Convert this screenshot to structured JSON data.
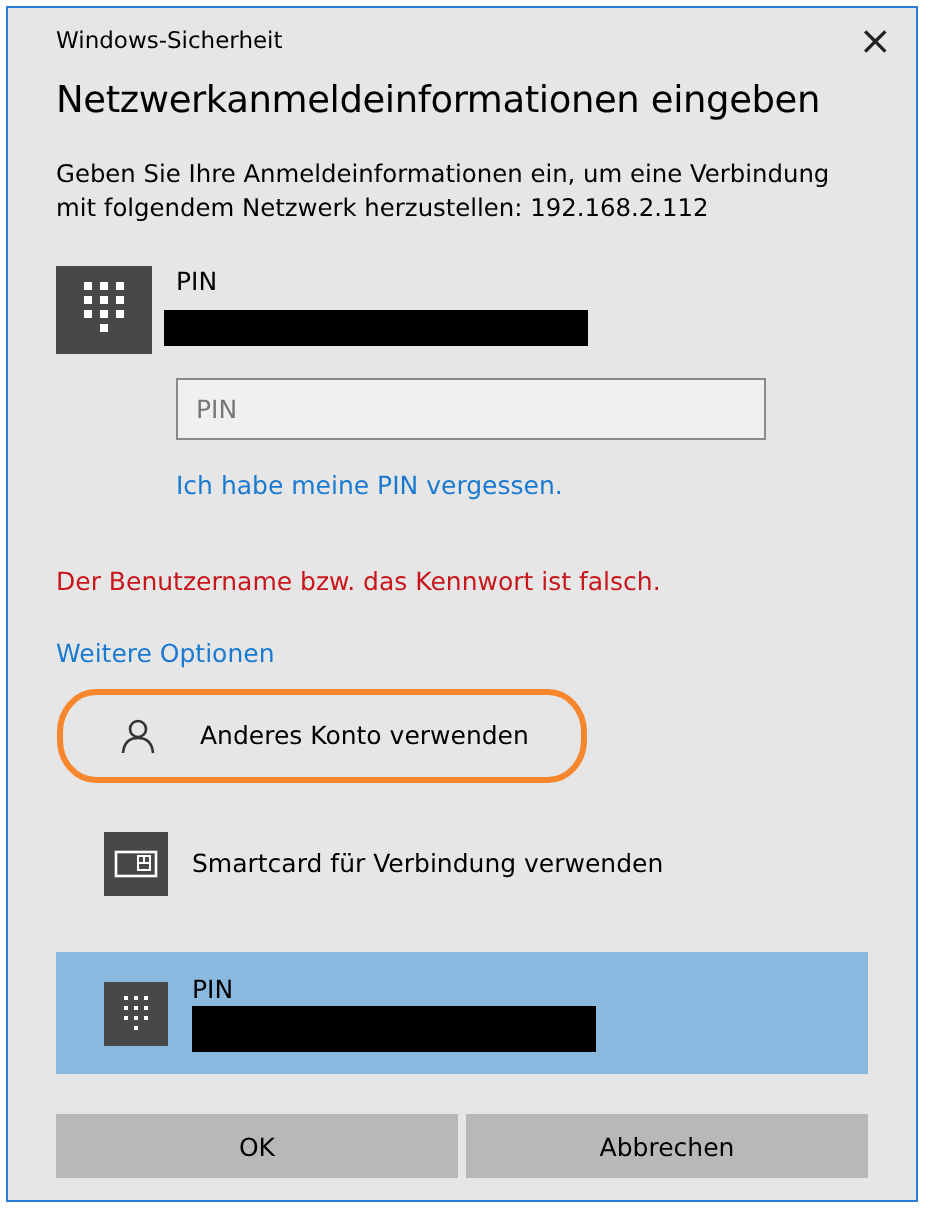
{
  "window": {
    "title": "Windows-Sicherheit",
    "close": "×"
  },
  "heading": "Netzwerkanmeldeinformationen eingeben",
  "description": "Geben Sie Ihre Anmeldeinformationen ein, um eine Verbindung mit folgendem Netzwerk herzustellen: 192.168.2.112",
  "credential": {
    "label": "PIN",
    "redacted": true
  },
  "pin_field": {
    "placeholder": "PIN"
  },
  "forgot_link": "Ich habe meine PIN vergessen.",
  "error": "Der Benutzername bzw. das Kennwort ist falsch.",
  "more_options": "Weitere Optionen",
  "options": [
    {
      "kind": "account",
      "label": "Anderes Konto verwenden",
      "selected": false,
      "highlighted": true
    },
    {
      "kind": "smartcard",
      "label": "Smartcard für Verbindung verwenden",
      "selected": false,
      "highlighted": false
    },
    {
      "kind": "pin",
      "label": "PIN",
      "redacted": true,
      "selected": true,
      "highlighted": false
    }
  ],
  "buttons": [
    "OK",
    "Abbrechen"
  ]
}
